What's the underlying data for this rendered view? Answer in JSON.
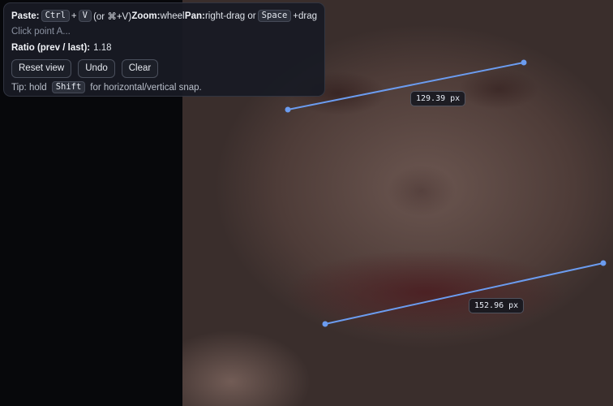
{
  "help": {
    "paste_label": "Paste:",
    "paste_key1": "Ctrl",
    "plus": "+",
    "paste_key2": "V",
    "paste_alt": "(or ⌘+V)",
    "zoom_label": "Zoom:",
    "zoom_value": "wheel",
    "pan_label": "Pan:",
    "pan_value": "right-drag or",
    "pan_key": "Space",
    "pan_suffix": "+drag"
  },
  "status": {
    "prompt": "Click point A..."
  },
  "ratio": {
    "label": "Ratio (prev / last):",
    "value": "1.18"
  },
  "buttons": {
    "reset_view": "Reset view",
    "undo": "Undo",
    "clear": "Clear"
  },
  "tip": {
    "prefix": "Tip: hold",
    "key": "Shift",
    "suffix": "for horizontal/vertical snap."
  },
  "measurements": [
    {
      "label": "129.39 px"
    },
    {
      "label": "152.96 px"
    }
  ],
  "colors": {
    "line": "#6b9cf0",
    "panel_bg": "#181b24"
  }
}
